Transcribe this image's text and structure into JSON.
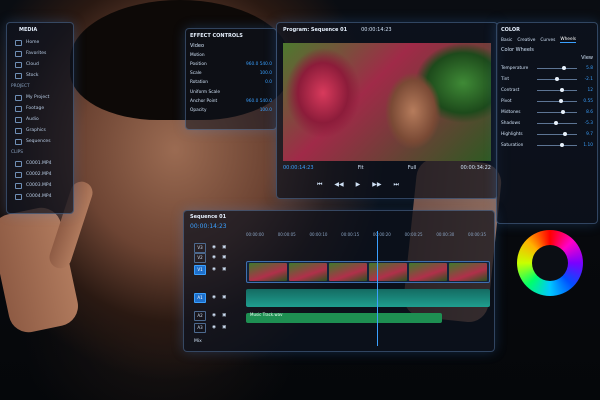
{
  "media_panel": {
    "title": "MEDIA",
    "items": [
      "Home",
      "Favorites",
      "Cloud",
      "Stock"
    ],
    "project_header": "PROJECT",
    "project_items": [
      "My Project",
      "Footage",
      "Audio",
      "Graphics",
      "Sequences"
    ],
    "clips_header": "CLIPS",
    "clips": [
      "C0001.MP4",
      "C0002.MP4",
      "C0003.MP4",
      "C0004.MP4"
    ]
  },
  "effect_controls": {
    "title": "EFFECT CONTROLS",
    "section": "Video",
    "rows": [
      {
        "label": "Motion",
        "v1": "",
        "v2": ""
      },
      {
        "label": "Position",
        "v1": "960.0",
        "v2": "540.0"
      },
      {
        "label": "Scale",
        "v1": "100.0",
        "v2": ""
      },
      {
        "label": "Rotation",
        "v1": "0.0",
        "v2": ""
      },
      {
        "label": "Uniform Scale",
        "v1": "",
        "v2": ""
      },
      {
        "label": "Anchor Point",
        "v1": "960.0",
        "v2": "540.0"
      },
      {
        "label": "Opacity",
        "v1": "100.0",
        "v2": ""
      }
    ]
  },
  "program": {
    "title": "Program: Sequence 01",
    "timecode_top": "00:00:14:23",
    "timecode_left": "00:00:14:23",
    "fit": "Fit",
    "full": "Full",
    "timecode_right": "00:00:34:22"
  },
  "color_panel": {
    "title": "COLOR",
    "tabs": [
      "Basic",
      "Creative",
      "Curves",
      "Wheels"
    ],
    "active_tab": "Wheels",
    "section": "Color Wheels",
    "view_label": "View",
    "rows": [
      {
        "label": "Temperature",
        "value": "5.8",
        "pos": 0.62
      },
      {
        "label": "Tint",
        "value": "-2.1",
        "pos": 0.45
      },
      {
        "label": "Contrast",
        "value": "12",
        "pos": 0.58
      },
      {
        "label": "Pivot",
        "value": "0.55",
        "pos": 0.55
      },
      {
        "label": "Midtones",
        "value": "8.6",
        "pos": 0.6
      },
      {
        "label": "Shadows",
        "value": "-5.3",
        "pos": 0.42
      },
      {
        "label": "Highlights",
        "value": "9.7",
        "pos": 0.64
      },
      {
        "label": "Saturation",
        "value": "1.10",
        "pos": 0.57
      }
    ]
  },
  "timeline": {
    "title": "Sequence 01",
    "timecode": "00:00:14:23",
    "ruler_times": [
      "00:00:00",
      "00:00:05",
      "00:00:10",
      "00:00:15",
      "00:00:20",
      "00:00:25",
      "00:00:30",
      "00:00:35"
    ],
    "tracks": [
      "V3",
      "V2",
      "V1",
      "A1",
      "A2",
      "A3"
    ],
    "mix_label": "Mix",
    "audio_clip_label": "Music Track.wav"
  },
  "colors": {
    "accent": "#3aa0ff",
    "clip_green": "#2dbb6a",
    "audio_teal": "#1f9e8f"
  }
}
